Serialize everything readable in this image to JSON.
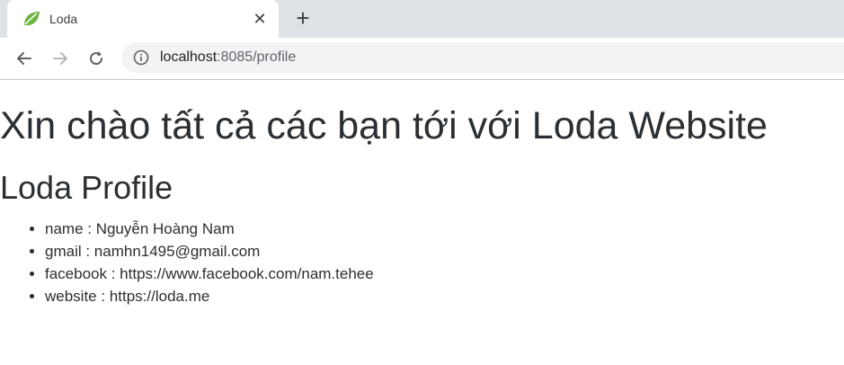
{
  "tab": {
    "title": "Loda",
    "favicon": "spring-leaf-icon",
    "close_glyph": "✕",
    "new_tab_glyph": "+"
  },
  "toolbar": {
    "url_host": "localhost",
    "url_rest": ":8085/profile"
  },
  "page": {
    "heading": "Xin chào tất cả các bạn tới với Loda Website",
    "subheading": "Loda Profile",
    "profile": [
      {
        "key": "name",
        "value": "Nguyễn Hoàng Nam",
        "text": "name : Nguyễn Hoàng Nam"
      },
      {
        "key": "gmail",
        "value": "namhn1495@gmail.com",
        "text": "gmail : namhn1495@gmail.com"
      },
      {
        "key": "facebook",
        "value": "https://www.facebook.com/nam.tehee",
        "text": "facebook : https://www.facebook.com/nam.tehee"
      },
      {
        "key": "website",
        "value": "https://loda.me",
        "text": "website : https://loda.me"
      }
    ]
  },
  "colors": {
    "tabstrip": "#dee1e6",
    "omnibox": "#f1f3f4",
    "text": "#2a2f33",
    "favicon": "#6db33f"
  }
}
